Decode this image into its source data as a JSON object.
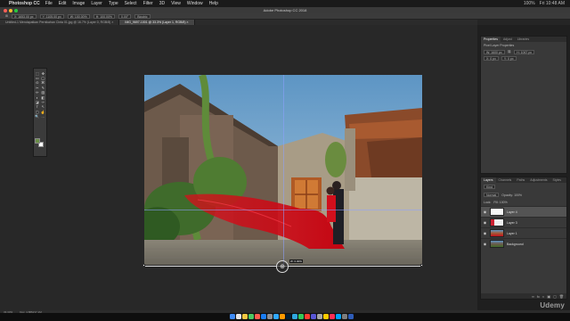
{
  "menubar": {
    "apple": "",
    "app_name": "Photoshop CC",
    "items": [
      "File",
      "Edit",
      "Image",
      "Layer",
      "Type",
      "Select",
      "Filter",
      "3D",
      "View",
      "Window",
      "Help"
    ],
    "status": [
      "100%",
      "Fri 10:48 AM"
    ]
  },
  "window": {
    "title": "Adobe Photoshop CC 2018"
  },
  "options": {
    "x": "X: 1653.00 px",
    "y": "Y: 1105.00 px",
    "w": "W: 100.00%",
    "h": "H: 100.00%",
    "angle": "0.00°",
    "interp": "Bicubic"
  },
  "tabs": [
    {
      "label": "Untitled-1 Mendapatkan Pernikahan Cinta 01.jpg @ 16.7% (Layer 0, RGB/8) ×",
      "active": false
    },
    {
      "label": "IMG_9697-1001 @ 33.3% (Layer 1, RGB/8) ×",
      "active": true
    }
  ],
  "toolbar": {
    "tools": [
      "⬚",
      "✥",
      "▭",
      "◯",
      "ʘ",
      "⌘",
      "✂",
      "✎",
      "✏",
      "▨",
      "◐",
      "◧",
      "◪",
      "✑",
      "T",
      "↖",
      "▢",
      "☝",
      "🔍",
      "…"
    ],
    "foreground_color": "#6a8f48",
    "background_color": "#ffffff"
  },
  "canvas": {
    "dimension_tooltip": "W: 0.00%",
    "move_cursor": "⊕"
  },
  "properties": {
    "tabs": [
      "Properties",
      "Adjust",
      "Libraries"
    ],
    "subtitle": "Pixel Layer Properties",
    "w": "W: 1600 px",
    "h": "H: 1067 px",
    "x": "X: 0 px",
    "y": "Y: 0 px",
    "link": "⛓"
  },
  "layers": {
    "tabs": [
      "Layers",
      "Channels",
      "Paths",
      "Adjustments",
      "Styles"
    ],
    "kind": "Kind",
    "blend": "Normal",
    "opacity": "Opacity: 100%",
    "lock": "Lock:",
    "fill": "Fill: 100%",
    "items": [
      {
        "name": "Layer 4",
        "visible": "◉",
        "selected": true
      },
      {
        "name": "Layer 3",
        "visible": "◉",
        "selected": false
      },
      {
        "name": "Layer 1",
        "visible": "◉",
        "selected": false
      },
      {
        "name": "Background",
        "visible": "◉",
        "selected": false
      }
    ],
    "footer": [
      "∞",
      "fx",
      "◐",
      "▣",
      "▢",
      "🗑"
    ]
  },
  "statusbar": {
    "zoom": "33.33%",
    "doc": "Doc: 4.88M/17.1M"
  },
  "dock": {
    "colors": [
      "#3d8af7",
      "#e6e6e6",
      "#f3c742",
      "#4cc764",
      "#ff5b4e",
      "#1a7df5",
      "#8e8e93",
      "#31a8ff",
      "#ff9a00",
      "#001e36",
      "#2fa7e0",
      "#34c759",
      "#ff3b30",
      "#5856d6",
      "#a6a6a6",
      "#ffcc00",
      "#ff2d55",
      "#00a2ff",
      "#7d7d7d",
      "#2e5cb8"
    ]
  },
  "watermark": "Udemy"
}
